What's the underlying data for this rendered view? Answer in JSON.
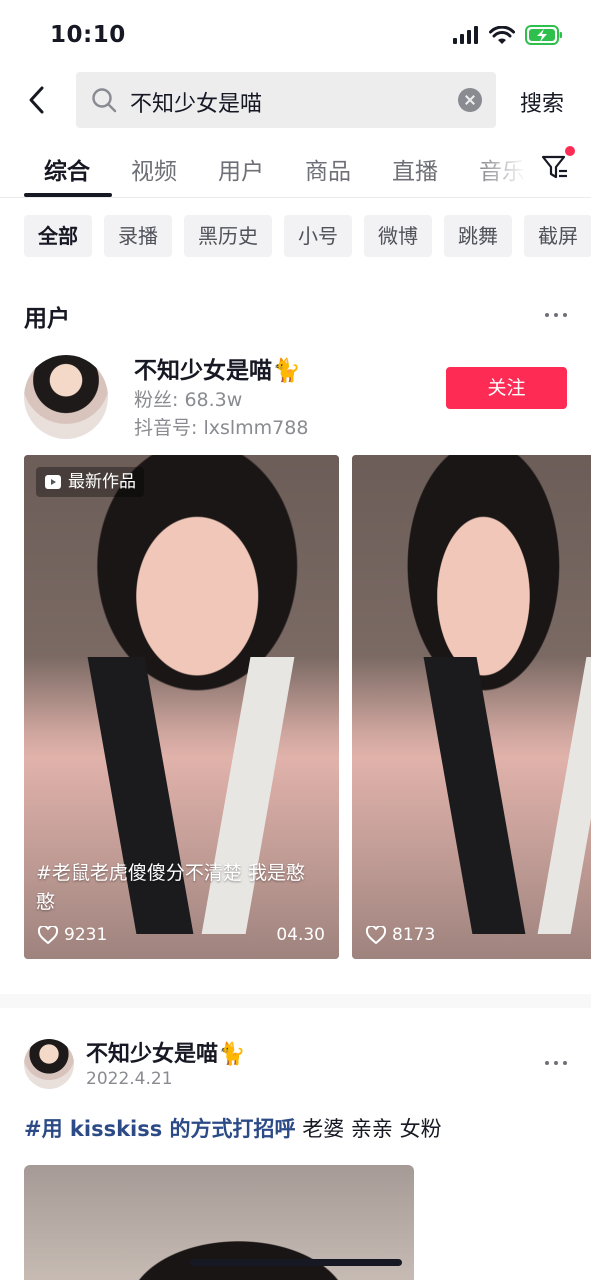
{
  "status_bar": {
    "time": "10:10"
  },
  "search": {
    "query": "不知少女是喵",
    "submit_label": "搜索"
  },
  "tabs": [
    {
      "label": "综合",
      "active": true
    },
    {
      "label": "视频"
    },
    {
      "label": "用户"
    },
    {
      "label": "商品"
    },
    {
      "label": "直播"
    },
    {
      "label": "音乐"
    }
  ],
  "chips": [
    "全部",
    "录播",
    "黑历史",
    "小号",
    "微博",
    "跳舞",
    "截屏"
  ],
  "user_section": {
    "title": "用户",
    "user": {
      "name": "不知少女是喵🐈",
      "fans": "粉丝: 68.3w",
      "douyin_id": "抖音号: lxslmm788",
      "follow_label": "关注"
    },
    "videos": [
      {
        "badge": "最新作品",
        "caption": "#老鼠老虎傻傻分不清楚 我是憨憨",
        "likes": "9231",
        "date": "04.30"
      },
      {
        "likes": "8173"
      }
    ]
  },
  "post": {
    "author": "不知少女是喵🐈",
    "date": "2022.4.21",
    "hashtag": "#用 kisskiss 的方式打招呼",
    "text": " 老婆 亲亲 女粉"
  },
  "colors": {
    "accent": "#fe2c55",
    "hashtag": "#2b4a86",
    "text": "#161823",
    "secondary": "#8a8b91"
  }
}
